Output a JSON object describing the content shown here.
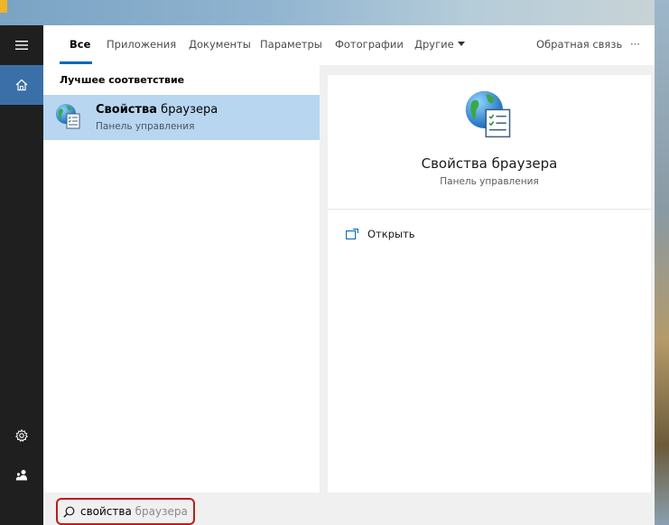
{
  "tabs": {
    "all": "Все",
    "apps": "Приложения",
    "documents": "Документы",
    "settings": "Параметры",
    "photos": "Фотографии",
    "more": "Другие",
    "feedback": "Обратная связь",
    "ellipsis": "···"
  },
  "results": {
    "heading": "Лучшее соответствие",
    "best_match": {
      "title_bold": "Свойства",
      "title_rest": " браузера",
      "subtitle": "Панель управления"
    }
  },
  "preview": {
    "title": "Свойства браузера",
    "subtitle": "Панель управления",
    "action_open": "Открыть"
  },
  "search": {
    "typed": "свойства",
    "suggestion": " браузера"
  },
  "icons": {
    "menu": "hamburger-icon",
    "home": "home-icon",
    "settings": "gear-icon",
    "user": "user-icon",
    "search": "search-icon",
    "open": "open-icon",
    "app": "internet-options-icon"
  },
  "colors": {
    "accent": "#0067c0",
    "selection": "#b8d6f0",
    "rail": "#1f1f1f",
    "rail_active": "#3b6fa8",
    "highlight_border": "#c21a1a"
  }
}
